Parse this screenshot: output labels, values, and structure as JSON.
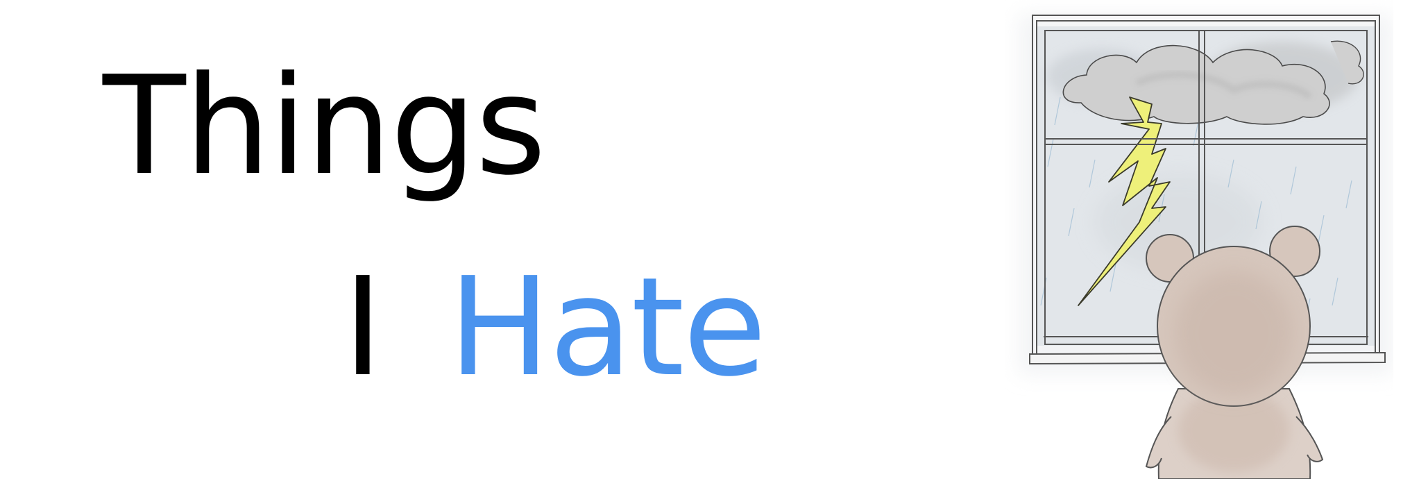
{
  "title": {
    "line1": "Things",
    "line2_word1": "I",
    "line2_word2": "Hate"
  },
  "colors": {
    "title_text": "#000000",
    "accent": "#4a93ee",
    "window_frame": "#555555",
    "glass": "#dde2e6",
    "cloud": "#c9c9c9",
    "lightning": "#eef07a",
    "bear": "#d6c6bc"
  },
  "illustration": {
    "subject": "bear-looking-out-window-at-storm"
  }
}
